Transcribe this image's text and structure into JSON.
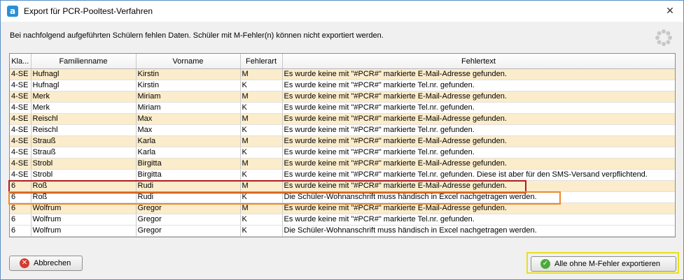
{
  "window": {
    "title": "Export für PCR-Pooltest-Verfahren",
    "close_glyph": "✕",
    "app_icon_letter": "a"
  },
  "message": "Bei nachfolgend aufgeführten Schülern fehlen Daten. Schüler mit M-Fehler(n) können nicht exportiert werden.",
  "table": {
    "columns": [
      "Kla...",
      "Familienname",
      "Vorname",
      "Fehlerart",
      "Fehlertext"
    ],
    "rows": [
      [
        "4-SE",
        "Hufnagl",
        "Kirstin",
        "M",
        "Es wurde keine mit \"#PCR#\" markierte E-Mail-Adresse gefunden."
      ],
      [
        "4-SE",
        "Hufnagl",
        "Kirstin",
        "K",
        "Es wurde keine mit \"#PCR#\" markierte Tel.nr. gefunden."
      ],
      [
        "4-SE",
        "Merk",
        "Miriam",
        "M",
        "Es wurde keine mit \"#PCR#\" markierte E-Mail-Adresse gefunden."
      ],
      [
        "4-SE",
        "Merk",
        "Miriam",
        "K",
        "Es wurde keine mit \"#PCR#\" markierte Tel.nr. gefunden."
      ],
      [
        "4-SE",
        "Reischl",
        "Max",
        "M",
        "Es wurde keine mit \"#PCR#\" markierte E-Mail-Adresse gefunden."
      ],
      [
        "4-SE",
        "Reischl",
        "Max",
        "K",
        "Es wurde keine mit \"#PCR#\" markierte Tel.nr. gefunden."
      ],
      [
        "4-SE",
        "Strauß",
        "Karla",
        "M",
        "Es wurde keine mit \"#PCR#\" markierte E-Mail-Adresse gefunden."
      ],
      [
        "4-SE",
        "Strauß",
        "Karla",
        "K",
        "Es wurde keine mit \"#PCR#\" markierte Tel.nr. gefunden."
      ],
      [
        "4-SE",
        "Strobl",
        "Birgitta",
        "M",
        "Es wurde keine mit \"#PCR#\" markierte E-Mail-Adresse gefunden."
      ],
      [
        "4-SE",
        "Strobl",
        "Birgitta",
        "K",
        "Es wurde keine mit \"#PCR#\" markierte Tel.nr. gefunden. Diese ist aber für den SMS-Versand verpflichtend."
      ],
      [
        "6",
        "Roß",
        "Rudi",
        "M",
        "Es wurde keine mit \"#PCR#\" markierte E-Mail-Adresse gefunden."
      ],
      [
        "6",
        "Roß",
        "Rudi",
        "K",
        "Die Schüler-Wohnanschrift muss händisch in Excel nachgetragen werden."
      ],
      [
        "6",
        "Wolfrum",
        "Gregor",
        "M",
        "Es wurde keine mit \"#PCR#\" markierte E-Mail-Adresse gefunden."
      ],
      [
        "6",
        "Wolfrum",
        "Gregor",
        "K",
        "Es wurde keine mit \"#PCR#\" markierte Tel.nr. gefunden."
      ],
      [
        "6",
        "Wolfrum",
        "Gregor",
        "K",
        "Die Schüler-Wohnanschrift muss händisch in Excel nachgetragen werden."
      ]
    ]
  },
  "buttons": {
    "cancel": {
      "label": "Abbrechen",
      "icon": "cancel-icon",
      "glyph": "✕"
    },
    "export": {
      "label": "Alle ohne M-Fehler exportieren",
      "icon": "check-icon",
      "glyph": "✓"
    }
  },
  "colors": {
    "m_row": "#fbeccb",
    "k_row": "#ffffff",
    "highlight_red": "#b01e1e",
    "highlight_orange": "#ea8a2a",
    "highlight_yellow": "#e8e01c"
  }
}
